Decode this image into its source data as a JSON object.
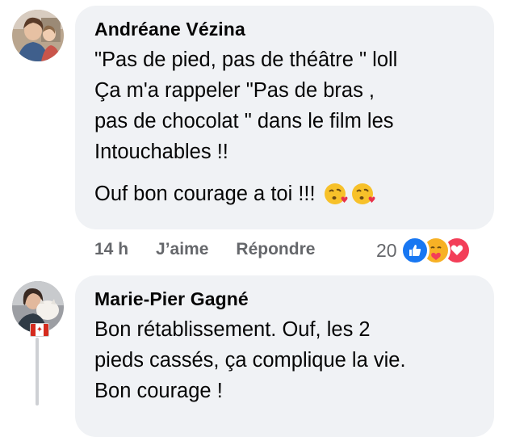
{
  "comments": [
    {
      "author": "Andréane Vézina",
      "paragraphs": [
        "\"Pas de pied, pas de théâtre \" loll",
        "Ça m'a rappeler \"Pas de bras ,",
        "pas de chocolat \" dans le film les",
        "Intouchables !!"
      ],
      "paragraph2": "Ouf bon courage a toi !!!",
      "emoji_icons": [
        "kissing-face-heart-icon",
        "kissing-face-heart-icon"
      ],
      "time": "14 h",
      "like_label": "J’aime",
      "reply_label": "Répondre",
      "reaction_count": "20",
      "reaction_icons": [
        "like-icon",
        "care-icon",
        "love-icon"
      ]
    },
    {
      "author": "Marie-Pier Gagné",
      "lines": [
        "Bon rétablissement. Ouf, les 2",
        "pieds cassés, ça complique la vie.",
        "Bon courage !"
      ],
      "avatar_badge": "canada-flag-icon"
    }
  ],
  "colors": {
    "bubble": "#f0f2f5",
    "muted": "#65676b",
    "like_blue": "#1877f2",
    "love_red": "#f33e58",
    "care_yellow": "#f7b125"
  }
}
